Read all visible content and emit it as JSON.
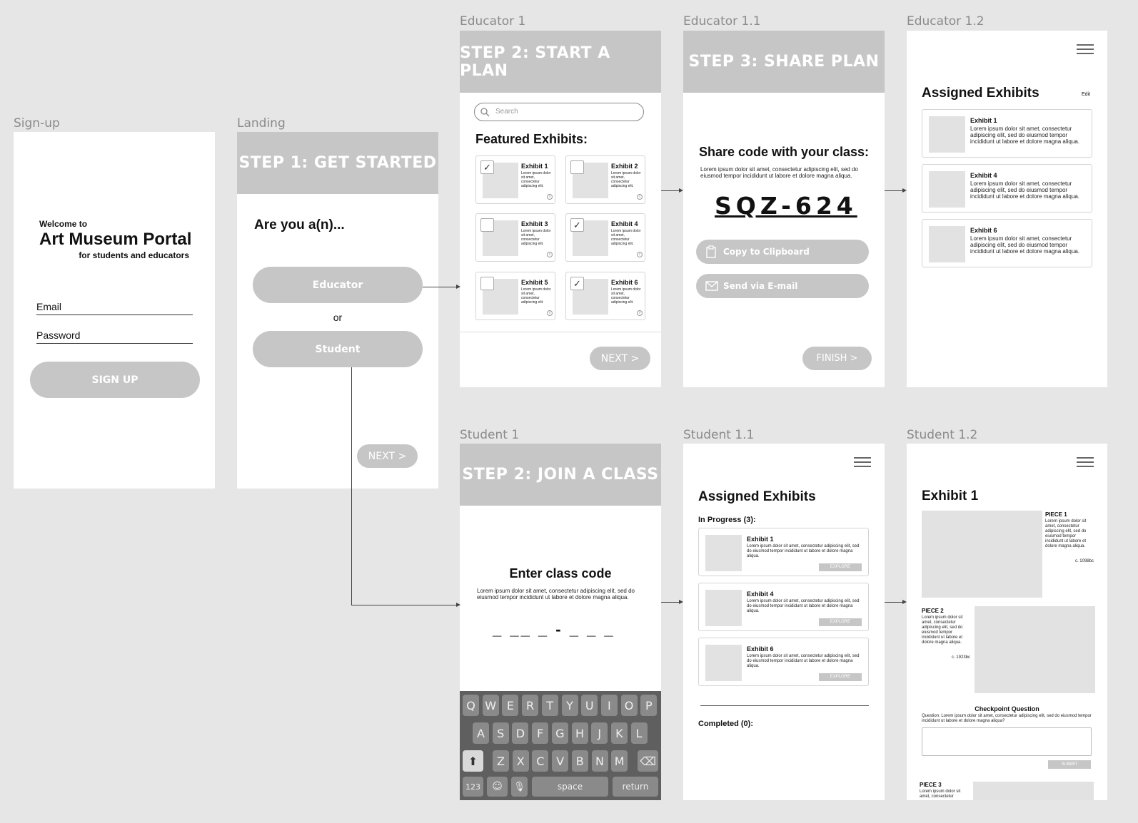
{
  "labels": {
    "signup": "Sign-up",
    "landing": "Landing",
    "edu1": "Educator 1",
    "edu11": "Educator 1.1",
    "edu12": "Educator 1.2",
    "stu1": "Student 1",
    "stu11": "Student 1.1",
    "stu12": "Student 1.2"
  },
  "signup": {
    "welcome": "Welcome to",
    "title": "Art Museum Portal",
    "subtitle": "for students and educators",
    "email_label": "Email",
    "password_label": "Password",
    "button": "SIGN UP"
  },
  "landing": {
    "header": "STEP 1: GET STARTED",
    "question": "Are you a(n)...",
    "educator": "Educator",
    "or": "or",
    "student": "Student",
    "next": "NEXT   >"
  },
  "edu1": {
    "header": "STEP 2: START A PLAN",
    "search_placeholder": "Search",
    "featured": "Featured Exhibits:",
    "lorem": "Lorem ipsum dolor sit amet, consectetur adipiscing elit.",
    "exhibits": [
      {
        "title": "Exhibit 1",
        "checked": "✓"
      },
      {
        "title": "Exhibit 2",
        "checked": ""
      },
      {
        "title": "Exhibit 3",
        "checked": ""
      },
      {
        "title": "Exhibit 4",
        "checked": "✓"
      },
      {
        "title": "Exhibit 5",
        "checked": ""
      },
      {
        "title": "Exhibit 6",
        "checked": "✓"
      }
    ],
    "next": "NEXT   >"
  },
  "edu11": {
    "header": "STEP 3: SHARE PLAN",
    "title": "Share code with your class:",
    "lorem": "Lorem ipsum dolor sit amet, consectetur adipiscing elit, sed do eiusmod tempor incididunt ut labore et dolore magna aliqua.",
    "code": "SQZ-624",
    "copy": "Copy to Clipboard",
    "email": "Send via E-mail",
    "finish": "FINISH >"
  },
  "edu12": {
    "title": "Assigned Exhibits",
    "edit": "Edit",
    "lorem": "Lorem ipsum dolor sit amet, consectetur adipiscing elit, sed do eiusmod tempor incididunt ut labore et dolore magna aliqua.",
    "items": [
      "Exhibit 1",
      "Exhibit 4",
      "Exhibit 6"
    ]
  },
  "stu1": {
    "header": "STEP 2: JOIN A CLASS",
    "title": "Enter class code",
    "lorem": "Lorem ipsum dolor sit amet, consectetur adipiscing elit, sed do eiusmod tempor incididunt ut labore et dolore magna aliqua.",
    "code_placeholder": "_ __ _ - _ _ _",
    "keyboard": {
      "row1": [
        "Q",
        "W",
        "E",
        "R",
        "T",
        "Y",
        "U",
        "I",
        "O",
        "P"
      ],
      "row2": [
        "A",
        "S",
        "D",
        "F",
        "G",
        "H",
        "J",
        "K",
        "L"
      ],
      "row3": [
        "Z",
        "X",
        "C",
        "V",
        "B",
        "N",
        "M"
      ],
      "num": "123",
      "space": "space",
      "return": "return"
    }
  },
  "stu11": {
    "title": "Assigned Exhibits",
    "in_progress": "In Progress (3):",
    "lorem": "Lorem ipsum dolor sit amet, consectetur adipiscing elit, sed do eiusmod tempor incididunt ut labore et dolore magna aliqua.",
    "items": [
      "Exhibit 1",
      "Exhibit 4",
      "Exhibit 6"
    ],
    "explore": "EXPLORE",
    "completed": "Completed (0):"
  },
  "stu12": {
    "title": "Exhibit 1",
    "piece1": "PIECE 1",
    "piece1_text": "Lorem ipsum dolor sit amet, consectetur adipiscing elit, sed do eiusmod tempor incididunt ut labore et dolore magna aliqua.",
    "piece1_date": "c. 1098bc",
    "piece2": "PIECE 2",
    "piece2_text": "Lorem ipsum dolor sit amet, consectetur adipiscing elit, sed do eiusmod tempor incididunt ut labore et dolore magna aliqua.",
    "piece2_date": "c. 1923bc",
    "checkpoint": "Checkpoint Question",
    "question": "Question: Lorem ipsum dolor sit amet, consectetur adipiscing elit, sed do eiusmod tempor incididunt ut labore et dolore magna aliqua?",
    "submit": "SUBMIT",
    "piece3": "PIECE 3",
    "piece3_text": "Lorem ipsum dolor sit amet, consectetur"
  }
}
